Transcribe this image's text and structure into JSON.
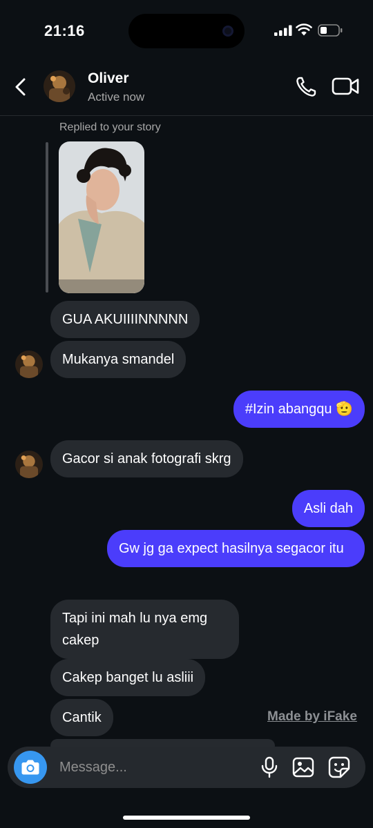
{
  "status_bar": {
    "time": "21:16"
  },
  "header": {
    "name": "Oliver",
    "presence": "Active now"
  },
  "story": {
    "replied_label": "Replied to your story"
  },
  "messages": [
    {
      "from": "them",
      "text": "GUA AKUIIIINNNNN"
    },
    {
      "from": "them",
      "text": "Mukanya smandel"
    },
    {
      "from": "me",
      "text": "#Izin abangqu 🫡"
    },
    {
      "from": "them",
      "text": "Gacor si anak fotografi skrg"
    },
    {
      "from": "me",
      "text": "Asli dah"
    },
    {
      "from": "me",
      "text": "Gw jg ga expect hasilnya segacor itu"
    },
    {
      "from": "them",
      "text": "Tapi ini mah lu nya emg cakep"
    },
    {
      "from": "them",
      "text": "Cakep banget lu asliii"
    },
    {
      "from": "them",
      "text": "Cantik"
    }
  ],
  "watermark": "Made by iFake",
  "composer": {
    "placeholder": "Message..."
  },
  "colors": {
    "outgoing_bubble": "#4b3dfb",
    "incoming_bubble": "#262a2f",
    "background": "#0c1014",
    "camera_button": "#3797f0"
  },
  "icons": [
    "back-chevron-icon",
    "phone-icon",
    "video-camera-icon",
    "camera-icon",
    "microphone-icon",
    "gallery-icon",
    "sticker-icon"
  ]
}
